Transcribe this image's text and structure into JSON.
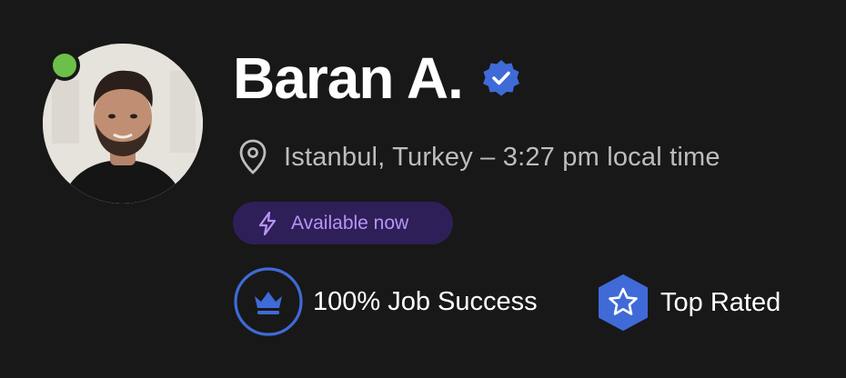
{
  "profile": {
    "name": "Baran A.",
    "location": "Istanbul, Turkey – 3:27 pm local time",
    "availability": "Available now",
    "online": true
  },
  "stats": {
    "job_success": "100% Job Success",
    "badge": "Top Rated"
  },
  "icons": {
    "verified": "verified-check-icon",
    "location": "location-pin-icon",
    "availability": "lightning-bolt-icon",
    "job_success": "crown-icon",
    "badge": "star-hexagon-icon"
  },
  "colors": {
    "background": "#181818",
    "online": "#6cc04a",
    "verified": "#3f6ad8",
    "availability_bg": "#2e1f58",
    "availability_text": "#b894f5",
    "accent_blue": "#3f6ad8"
  }
}
